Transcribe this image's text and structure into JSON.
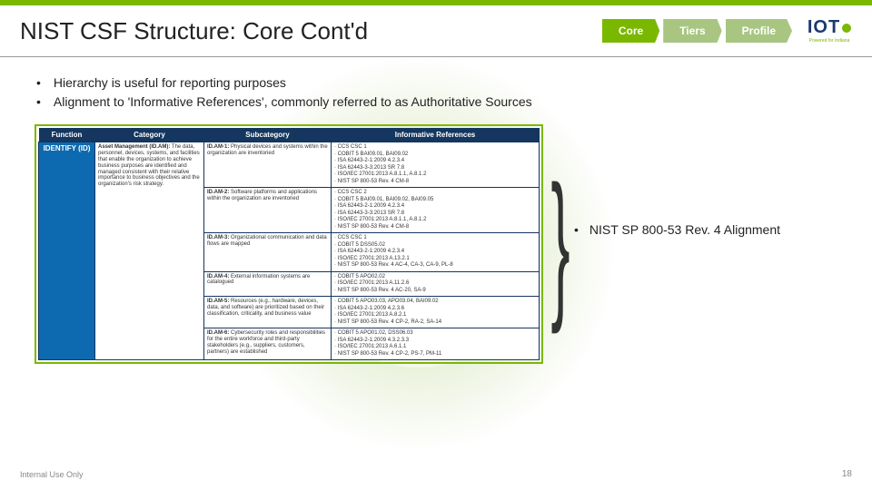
{
  "header": {
    "title": "NIST CSF Structure: Core Cont'd",
    "nav": {
      "core": "Core",
      "tiers": "Tiers",
      "profile": "Profile"
    },
    "logo": {
      "main": "IOT",
      "sub": "Powered for Indiana"
    }
  },
  "bullets": {
    "b1": "Hierarchy is useful for reporting purposes",
    "b2": "Alignment to 'Informative References', commonly referred to as Authoritative Sources"
  },
  "table": {
    "head": {
      "function": "Function",
      "category": "Category",
      "subcategory": "Subcategory",
      "refs": "Informative References"
    },
    "function": "IDENTIFY (ID)",
    "category_title": "Asset Management (ID.AM):",
    "category_body": "The data, personnel, devices, systems, and facilities that enable the organization to achieve business purposes are identified and managed consistent with their relative importance to business objectives and the organization's risk strategy.",
    "rows": [
      {
        "sub": "ID.AM-1: Physical devices and systems within the organization are inventoried",
        "refs": [
          "CCS CSC 1",
          "COBIT 5 BAI09.01, BAI09.02",
          "ISA 62443-2-1:2009 4.2.3.4",
          "ISA 62443-3-3:2013 SR 7.8",
          "ISO/IEC 27001:2013 A.8.1.1, A.8.1.2",
          "NIST SP 800-53 Rev. 4 CM-8"
        ]
      },
      {
        "sub": "ID.AM-2: Software platforms and applications within the organization are inventoried",
        "refs": [
          "CCS CSC 2",
          "COBIT 5 BAI09.01, BAI09.02, BAI09.05",
          "ISA 62443-2-1:2009 4.2.3.4",
          "ISA 62443-3-3:2013 SR 7.8",
          "ISO/IEC 27001:2013 A.8.1.1, A.8.1.2",
          "NIST SP 800-53 Rev. 4 CM-8"
        ]
      },
      {
        "sub": "ID.AM-3: Organizational communication and data flows are mapped",
        "refs": [
          "CCS CSC 1",
          "COBIT 5 DSS05.02",
          "ISA 62443-2-1:2009 4.2.3.4",
          "ISO/IEC 27001:2013 A.13.2.1",
          "NIST SP 800-53 Rev. 4 AC-4, CA-3, CA-9, PL-8"
        ]
      },
      {
        "sub": "ID.AM-4: External information systems are catalogued",
        "refs": [
          "COBIT 5 APO02.02",
          "ISO/IEC 27001:2013 A.11.2.6",
          "NIST SP 800-53 Rev. 4 AC-20, SA-9"
        ]
      },
      {
        "sub": "ID.AM-5: Resources (e.g., hardware, devices, data, and software) are prioritized based on their classification, criticality, and business value",
        "refs": [
          "COBIT 5 APO03.03, APO03.04, BAI09.02",
          "ISA 62443-2-1:2009 4.2.3.6",
          "ISO/IEC 27001:2013 A.8.2.1",
          "NIST SP 800-53 Rev. 4 CP-2, RA-2, SA-14"
        ]
      },
      {
        "sub": "ID.AM-6: Cybersecurity roles and responsibilities for the entire workforce and third-party stakeholders (e.g., suppliers, customers, partners) are established",
        "refs": [
          "COBIT 5 APO01.02, DSS06.03",
          "ISA 62443-2-1:2009 4.3.2.3.3",
          "ISO/IEC 27001:2013 A.6.1.1",
          "NIST SP 800-53 Rev. 4 CP-2, PS-7, PM-11"
        ]
      }
    ]
  },
  "callout": "NIST SP 800-53 Rev. 4 Alignment",
  "footer": {
    "left": "Internal Use Only",
    "right": "18"
  }
}
